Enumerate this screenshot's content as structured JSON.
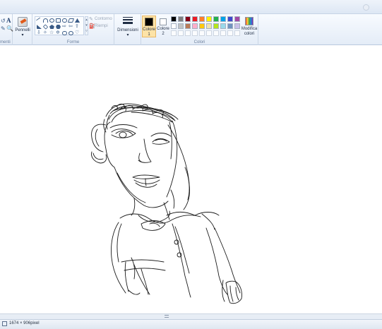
{
  "ribbon": {
    "groups": {
      "image_tail": "menti",
      "shapes": "Forme",
      "colors": "Colori"
    },
    "brushes_label": "Pennelli",
    "outline_label": "Contorno",
    "fill_label": "Riempi",
    "size_label": "Dimensioni",
    "color1_label": "Colore 1",
    "color2_label": "Colore 2",
    "edit_colors_label": "Modifica colori",
    "color1_value": "#000000",
    "color2_value": "#ffffff",
    "palette_row1": [
      "#000000",
      "#7f7f7f",
      "#880015",
      "#ed1c24",
      "#ff7f27",
      "#fff200",
      "#22b14c",
      "#00a2e8",
      "#3f48cc",
      "#a349a4"
    ],
    "palette_row2": [
      "#ffffff",
      "#c3c3c3",
      "#b97a57",
      "#ffaec9",
      "#ffc90e",
      "#efe4b0",
      "#b5e61d",
      "#99d9ea",
      "#7092be",
      "#c8bfe7"
    ]
  },
  "status": {
    "dimensions": "1674 × 906pixel"
  }
}
